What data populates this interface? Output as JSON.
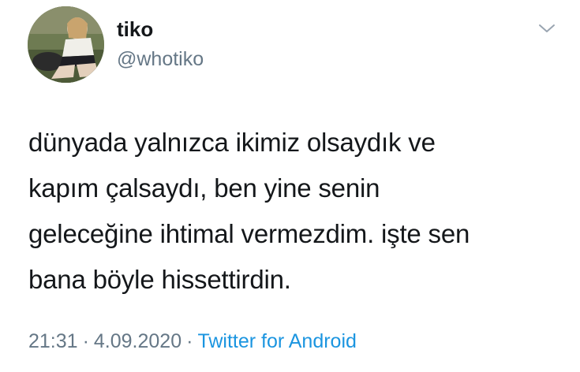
{
  "user": {
    "name": "tiko",
    "handle": "@whotiko"
  },
  "tweet": {
    "text_lines": [
      "dünyada yalnızca ikimiz olsaydık ve",
      "kapım çalsaydı, ben yine senin",
      "geleceğine ihtimal vermezdim. işte sen",
      "bana böyle hissettirdin."
    ],
    "time": "21:31",
    "separator": "·",
    "date": "4.09.2020",
    "source": "Twitter for Android"
  },
  "icons": {
    "menu": "chevron-down-icon"
  },
  "colors": {
    "text": "#14171a",
    "secondary": "#657786",
    "link": "#1b95e0"
  }
}
